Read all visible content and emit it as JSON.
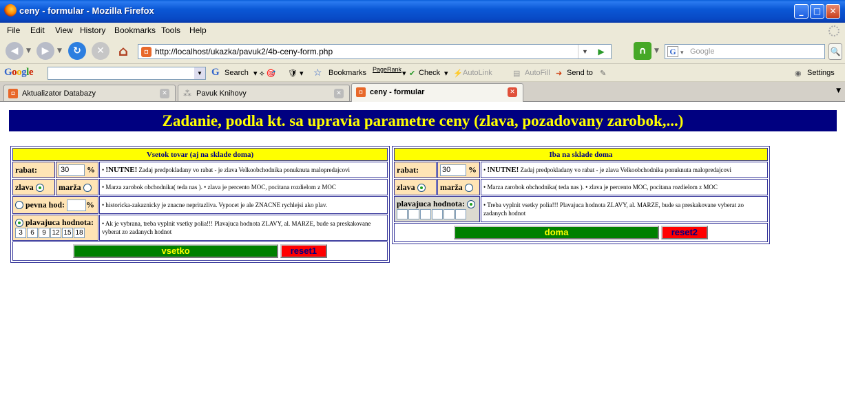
{
  "window": {
    "title": "ceny - formular - Mozilla Firefox"
  },
  "menu": [
    "File",
    "Edit",
    "View",
    "History",
    "Bookmarks",
    "Tools",
    "Help"
  ],
  "nav": {
    "url": "http://localhost/ukazka/pavuk2/4b-ceny-form.php",
    "search_placeholder": "Google"
  },
  "gtoolbar": {
    "logo": "Google",
    "search": "Search",
    "bookmarks": "Bookmarks",
    "pagerank": "PageRank",
    "check": "Check",
    "autolink": "AutoLink",
    "autofill": "AutoFill",
    "sendto": "Send to",
    "settings": "Settings"
  },
  "tabs": [
    {
      "label": "Aktualizator Databazy"
    },
    {
      "label": "Pavuk Knihovy"
    },
    {
      "label": "ceny - formular"
    }
  ],
  "page": {
    "banner": "Zadanie, podla kt. sa upravia parametre ceny (zlava, pozadovany zarobok,...)",
    "form1": {
      "header": "Vsetok tovar (aj na sklade doma)",
      "rabat_label": "rabat:",
      "rabat_value": "30",
      "percent": "%",
      "note1_bold": "!NUTNE!",
      "note1": "Zadaj predpokladany vo rabat - je zlava Velkoobchodnika ponuknuta malopredajcovi",
      "zlava_label": "zlava",
      "marza_label": "marža",
      "note2": "• Marza zarobok obchodnika( teda nas ). • zlava je percento MOC, pocitana rozdielom z MOC",
      "pevna_label": "pevna hod:",
      "pevna_value": "",
      "note3": "• historicka-zakaznicky je znacne nepritazliva. Vypocet je ale ZNACNE rychlejsi ako plav.",
      "plav_label": "plavajuca hodnota:",
      "plav_values": [
        "3",
        "6",
        "9",
        "12",
        "15",
        "18"
      ],
      "note4": "• Ak je vybrana, treba vyplnit vsetky polia!!! Plavajuca hodnota ZLAVY, al. MARZE, bude sa preskakovane vyberat zo zadanych hodnot",
      "submit": "vsetko",
      "reset": "reset1"
    },
    "form2": {
      "header": "Iba na sklade doma",
      "rabat_label": "rabat:",
      "rabat_value": "30",
      "percent": "%",
      "note1_bold": "!NUTNE!",
      "note1": "Zadaj predpokladany vo rabat - je zlava Velkoobchodnika ponuknuta malopredajcovi",
      "zlava_label": "zlava",
      "marza_label": "marža",
      "note2": "• Marza zarobok obchodnika( teda nas ). • zlava je percento MOC, pocitana rozdielom z MOC",
      "plav_label": "plavajuca hodnota:",
      "plav_values": [
        "",
        "",
        "",
        "",
        "",
        ""
      ],
      "note3": "• Treba vyplnit vsetky polia!!! Plavajuca hodnota ZLAVY, al. MARZE, bude sa preskakovane vyberat zo zadanych hodnot",
      "submit": "doma",
      "reset": "reset2"
    }
  }
}
